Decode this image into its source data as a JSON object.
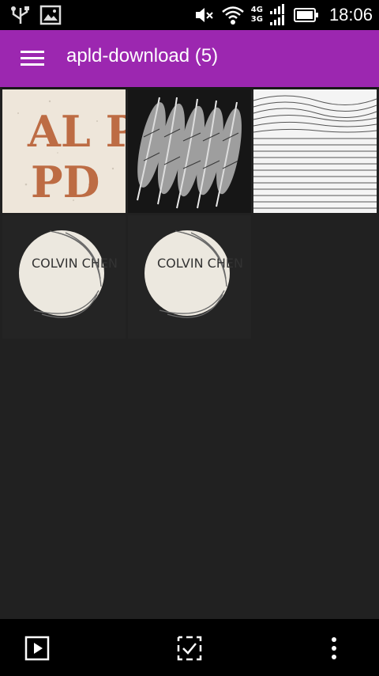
{
  "status_bar": {
    "time": "18:06",
    "network_top": "4G",
    "network_bottom": "3G",
    "icons": [
      "usb-icon",
      "image-notification-icon",
      "mute-icon",
      "wifi-icon",
      "signal-icon",
      "battery-icon"
    ]
  },
  "app_bar": {
    "title": "apld-download (5)",
    "menu_icon": "hamburger-menu-icon",
    "color": "#9c27b0"
  },
  "gallery": {
    "items": [
      {
        "label": "AL PD",
        "icon": "image-thumbnail"
      },
      {
        "label": "",
        "icon": "feathers-thumbnail"
      },
      {
        "label": "",
        "icon": "wavy-lines-thumbnail"
      },
      {
        "label": "COLVIN CHEN",
        "icon": "logo-thumbnail"
      },
      {
        "label": "COLVIN CHEN",
        "icon": "logo-thumbnail"
      }
    ]
  },
  "bottom_bar": {
    "buttons": [
      "slideshow-icon",
      "select-icon",
      "more-options-icon"
    ]
  }
}
